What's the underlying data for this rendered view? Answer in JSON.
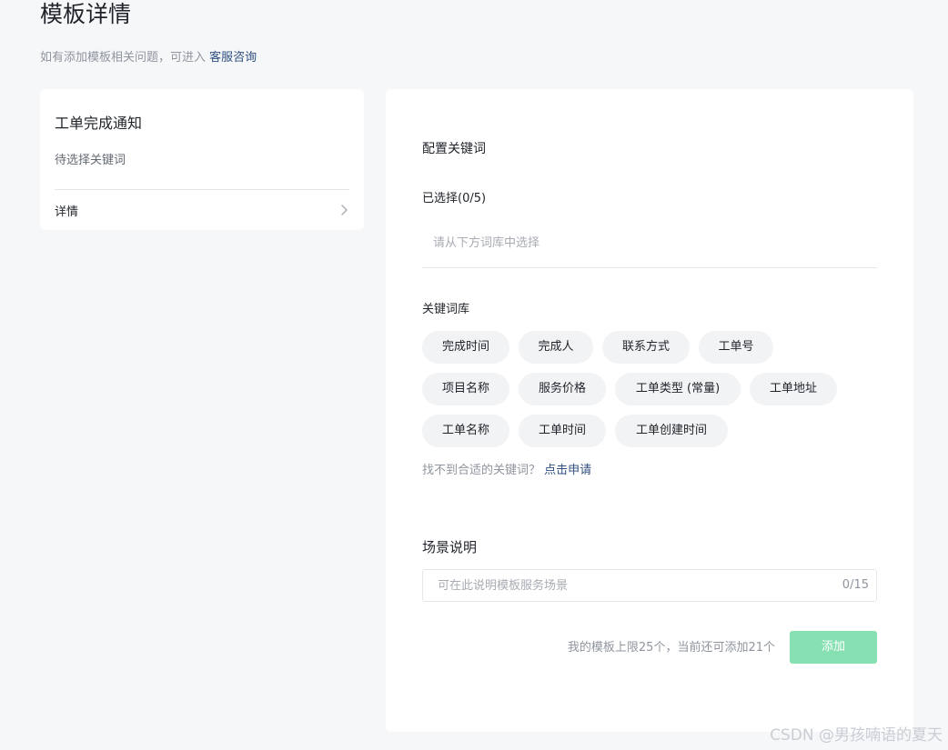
{
  "header": {
    "title": "模板详情",
    "subtitle_prefix": "如有添加模板相关问题，可进入",
    "subtitle_link": "客服咨询"
  },
  "template_card": {
    "title": "工单完成通知",
    "description": "待选择关键词",
    "detail_label": "详情",
    "detail_icon": "chevron-right-icon"
  },
  "config": {
    "section_title": "配置关键词",
    "selected_label": "已选择(0/5)",
    "selected_placeholder": "请从下方词库中选择",
    "library_label": "关键词库",
    "keywords": [
      "完成时间",
      "完成人",
      "联系方式",
      "工单号",
      "项目名称",
      "服务价格",
      "工单类型 (常量)",
      "工单地址",
      "工单名称",
      "工单时间",
      "工单创建时间"
    ],
    "help_prefix": "找不到合适的关键词？",
    "help_link": "点击申请"
  },
  "scene": {
    "title": "场景说明",
    "placeholder": "可在此说明模板服务场景",
    "value": "",
    "counter": "0/15"
  },
  "footer": {
    "limit_note": "我的模板上限25个，当前还可添加21个",
    "add_label": "添加"
  },
  "colors": {
    "background": "#f6f7f9",
    "card": "#ffffff",
    "link": "#2f4f7f",
    "chip": "#f2f3f5",
    "add_button_disabled": "#87e0b1"
  },
  "watermark": "CSDN @男孩喃语的夏天"
}
